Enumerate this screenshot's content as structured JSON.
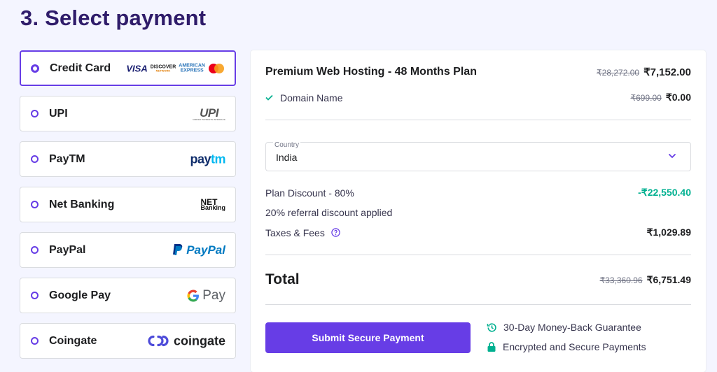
{
  "page": {
    "title": "3. Select payment"
  },
  "payment_methods": [
    {
      "label": "Credit Card",
      "selected": true,
      "logos": [
        "VISA",
        "DISCOVER",
        "AMERICAN EXPRESS",
        "mastercard"
      ]
    },
    {
      "label": "UPI",
      "selected": false,
      "logo_text": "UPI",
      "logo_sub": "UNIFIED PAYMENTS INTERFACE"
    },
    {
      "label": "PayTM",
      "selected": false,
      "logo_text": "pay",
      "logo_text2": "tm"
    },
    {
      "label": "Net Banking",
      "selected": false,
      "logo_text": "NET",
      "logo_sub": "Banking"
    },
    {
      "label": "PayPal",
      "selected": false,
      "logo_text": "Pay",
      "logo_text2": "Pal"
    },
    {
      "label": "Google Pay",
      "selected": false,
      "logo_text": "Pay"
    },
    {
      "label": "Coingate",
      "selected": false,
      "logo_text": "coingate"
    }
  ],
  "card_logos": {
    "visa": "VISA",
    "discover": "DISCOVER",
    "discover_sub": "NETWORK",
    "amex_1": "AMERICAN",
    "amex_2": "EXPRESS"
  },
  "order": {
    "plan_name": "Premium Web Hosting - 48 Months Plan",
    "plan_old_price": "₹28,272.00",
    "plan_price": "₹7,152.00",
    "domain_label": "Domain Name",
    "domain_old_price": "₹699.00",
    "domain_price": "₹0.00",
    "country_label": "Country",
    "country_value": "India",
    "discount_label": "Plan Discount - 80%",
    "discount_value": "-₹22,550.40",
    "referral_note": "20% referral discount applied",
    "taxes_label": "Taxes & Fees",
    "taxes_value": "₹1,029.89",
    "total_label": "Total",
    "total_old_price": "₹33,360.96",
    "total_price": "₹6,751.49",
    "submit_label": "Submit Secure Payment",
    "guarantee_1": "30-Day Money-Back Guarantee",
    "guarantee_2": "Encrypted and Secure Payments"
  },
  "colors": {
    "accent": "#673de6",
    "success": "#00b090",
    "title": "#2f1c6a"
  },
  "icons": [
    "check-icon",
    "chevron-down-icon",
    "help-circle-icon",
    "history-icon",
    "lock-icon"
  ]
}
